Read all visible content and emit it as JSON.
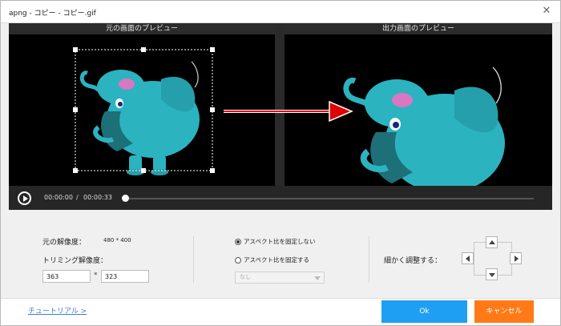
{
  "window": {
    "title": "apng - コピー - コピー.gif"
  },
  "preview": {
    "left_title": "元の画面のプレビュー",
    "right_title": "出力画面のプレビュー"
  },
  "player": {
    "current_time": "00:00:00",
    "separator": "/",
    "total_time": "00:00:33",
    "progress": 0.0
  },
  "settings": {
    "original_resolution_label": "元の解像度：",
    "original_resolution_value": "480 * 400",
    "trim_resolution_label": "トリミング解像度：",
    "trim_width": "363",
    "trim_separator": "*",
    "trim_height": "323",
    "aspect_free_label": "アスペクト比を固定しない",
    "aspect_fixed_label": "アスペクト比を固定する",
    "aspect_selected": "free",
    "aspect_ratio_select": "なし",
    "fine_adjust_label": "細かく調整する："
  },
  "footer": {
    "tutorial_link": "チュートリアル >",
    "ok_label": "Ok",
    "cancel_label": "キャンセル"
  },
  "colors": {
    "ok_button": "#1f9ff3",
    "cancel_button": "#ff7a16",
    "link": "#3d7fd8",
    "elephant_body": "#2bb3c0",
    "arrow": "#e00000"
  },
  "icons": [
    "close-icon",
    "play-icon",
    "arrow-up-icon",
    "arrow-down-icon",
    "arrow-left-icon",
    "arrow-right-icon",
    "dropdown-arrow-icon"
  ]
}
